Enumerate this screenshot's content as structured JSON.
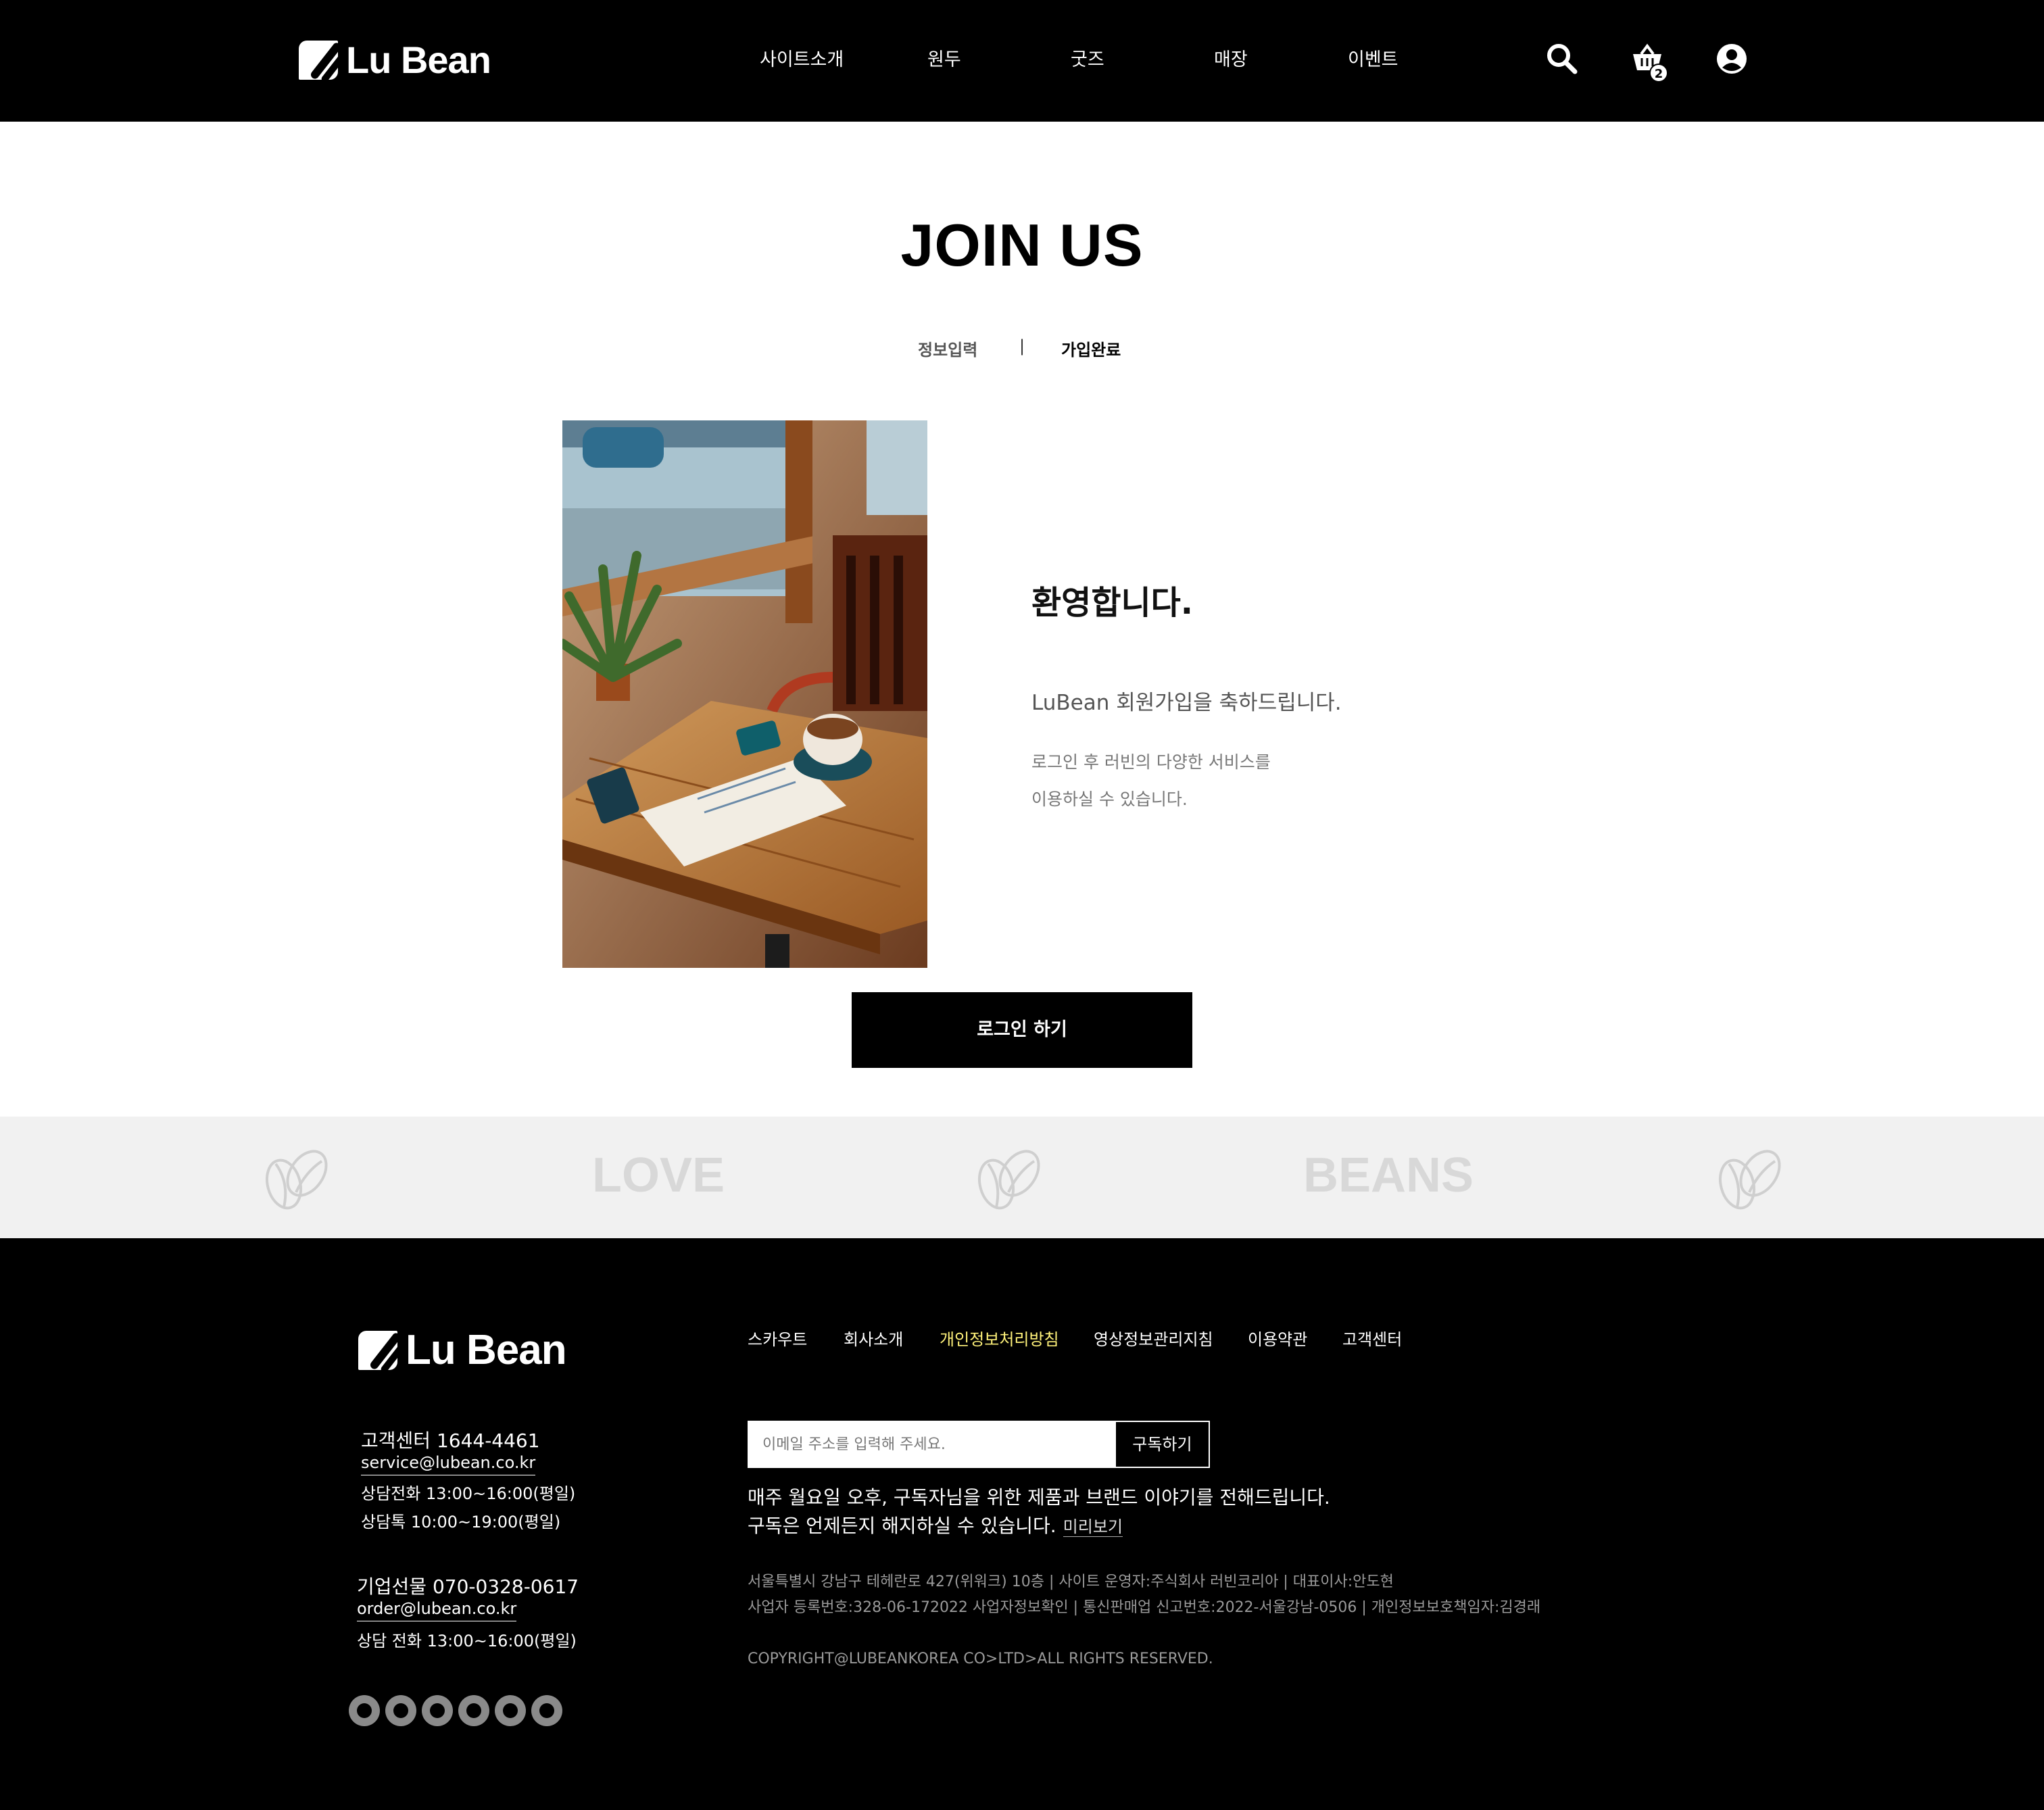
{
  "header": {
    "brand": "Lu Bean",
    "nav": [
      "사이트소개",
      "원두",
      "굿즈",
      "매장",
      "이벤트"
    ],
    "cart_count": "2"
  },
  "main": {
    "title": "JOIN US",
    "steps": [
      "정보입력",
      "|",
      "가입완료"
    ],
    "welcome_title": "환영합니다.",
    "welcome_subtitle": "LuBean 회원가입을 축하드립니다.",
    "welcome_desc": [
      "로그인 후 러빈의 다양한 서비스를",
      "이용하실 수 있습니다."
    ],
    "login_button": "로그인 하기"
  },
  "banner": {
    "words": [
      "LOVE",
      "BEANS"
    ]
  },
  "footer": {
    "brand": "Lu Bean",
    "customer_center": {
      "title": "고객센터 1644-4461",
      "email": "service@lubean.co.kr",
      "phone_hours": "상담전화 13:00~16:00(평일)",
      "talk_hours": "상담톡 10:00~19:00(평일)"
    },
    "corporate_gift": {
      "title": "기업선물 070-0328-0617",
      "email": "order@lubean.co.kr",
      "phone_hours": "상담 전화 13:00~16:00(평일)"
    },
    "links": [
      "스카우트",
      "회사소개",
      "개인정보처리방침",
      "영상정보관리지침",
      "이용약관",
      "고객센터"
    ],
    "highlight_color": "#fff27a",
    "subscribe": {
      "placeholder": "이메일 주소를 입력해 주세요.",
      "button": "구독하기",
      "line1": "매주 월요일 오후, 구독자님을 위한 제품과 브랜드 이야기를 전해드립니다.",
      "line2": "구독은 언제든지 해지하실 수 있습니다.",
      "preview": "미리보기"
    },
    "company_info": [
      "서울특별시 강남구 테헤란로 427(위워크) 10층 | 사이트 운영자:주식회사 러빈코리아 | 대표이사:안도현",
      "사업자 등록번호:328-06-172022 사업자정보확인 | 통신판매업 신고번호:2022-서울강남-0506 | 개인정보보호책임자:김경래"
    ],
    "copyright": "COPYRIGHT@LUBEANKOREA CO>LTD>ALL RIGHTS RESERVED.",
    "social_icons": [
      "github-icon",
      "reddit-icon",
      "github-icon",
      "reddit-icon",
      "github-icon",
      "reddit-icon"
    ]
  }
}
